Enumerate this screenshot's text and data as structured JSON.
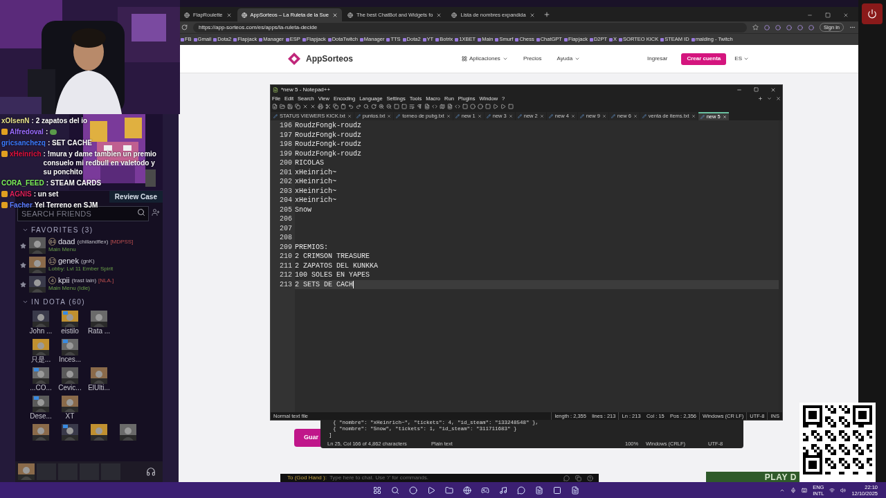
{
  "chat": {
    "messages": [
      {
        "kind": "text",
        "user": "xOlsenN",
        "color": "#e8e48a",
        "badge": false,
        "text": ": 2 zapatos del io"
      },
      {
        "kind": "emote",
        "user": "Alfredoval",
        "color": "#9b6bff",
        "badge": true,
        "text": ":"
      },
      {
        "kind": "text",
        "user": "gricsanchezq",
        "color": "#3c7bff",
        "badge": false,
        "text": ": SET CACHE"
      },
      {
        "kind": "text",
        "user": "xHeinrich",
        "color": "#e0103c",
        "badge": true,
        "text": ": !mura y dame tambien un premio consuelo mi redbull en valetodo y su ponchito"
      },
      {
        "kind": "text",
        "user": "CORA_FEED",
        "color": "#7cf05a",
        "badge": false,
        "text": ": STEAM CARDS"
      },
      {
        "kind": "text",
        "user": "AGNIS",
        "color": "#e0205a",
        "badge": true,
        "text": ": un set"
      },
      {
        "kind": "text",
        "user": "Facher",
        "color": "#5a7cff",
        "badge": true,
        "text": "Yel Terreno en SJM"
      }
    ]
  },
  "friends": {
    "review_button": "Review Case",
    "search": {
      "placeholder": "SEARCH FRIENDS"
    },
    "favorites": {
      "title": "FAVORITES",
      "count": "(3)",
      "expanded": true,
      "items": [
        {
          "level": "84",
          "name": "daad",
          "nick": "(chillandflex)",
          "tag": "[MDPSS]",
          "status": "Main Menu"
        },
        {
          "level": "12",
          "name": "genek",
          "nick": "(gnK)",
          "status": "Lobby: Lvl 11 Ember Spirit"
        },
        {
          "level": "4",
          "name": "kpii",
          "nick": "(trast lain)",
          "tag": "[NLA.]",
          "status": "Main Menu (Idle)"
        }
      ]
    },
    "in_dota": {
      "title": "IN DOTA",
      "count": "(60)",
      "expanded": true,
      "rows": [
        [
          {
            "name": "John ...",
            "plus": false
          },
          {
            "name": "eistilo",
            "plus": true
          },
          {
            "name": "Rata ...",
            "plus": false
          }
        ],
        [
          {
            "name": "只是...",
            "plus": false
          },
          {
            "name": "Inces...",
            "plus": true
          }
        ],
        [
          {
            "name": "...CO...",
            "plus": true
          },
          {
            "name": "Cevic...",
            "plus": false
          },
          {
            "name": "ElUlti...",
            "plus": false
          }
        ],
        [
          {
            "name": "Dese...",
            "plus": true
          },
          {
            "name": "XT",
            "plus": false
          }
        ],
        [
          {
            "plus": false
          },
          {
            "plus": true
          },
          {
            "plus": false
          },
          {
            "plus": false
          }
        ]
      ]
    }
  },
  "browser": {
    "tabs": [
      {
        "title": "FlapRoulette",
        "selected": false
      },
      {
        "title": "AppSorteos – La Ruleta de la Sue",
        "selected": true
      },
      {
        "title": "The best ChatBot and Widgets fo",
        "selected": false
      },
      {
        "title": "Lista de nombres expandida",
        "selected": false
      }
    ],
    "address": "https://app-sorteos.com/es/apps/la-ruleta-decide",
    "sign_in": "Sign in",
    "bookmarks": [
      "FB",
      "Gmail",
      "Dota2",
      "Flapjack",
      "Manager",
      "ESP",
      "Flapjack",
      "DotaTwitch",
      "Manager",
      "TTS",
      "Dota2",
      "YT",
      "Botrix",
      "1XBET",
      "Main",
      "Smurf",
      "Chess",
      "ChatGPT",
      "Flapjack",
      "D2PT",
      "X",
      "SORTEO KICK",
      "STEAM ID",
      "malding - Twitch"
    ]
  },
  "site": {
    "logo": "AppSorteos",
    "nav": [
      "Aplicaciones",
      "Precios",
      "Ayuda"
    ],
    "login": "Ingresar",
    "signup": "Crear cuenta",
    "language": "ES",
    "save_button": "Guar"
  },
  "notepad": {
    "title": "*new 5 - Notepad++",
    "menu": [
      "File",
      "Edit",
      "Search",
      "View",
      "Encoding",
      "Language",
      "Settings",
      "Tools",
      "Macro",
      "Run",
      "Plugins",
      "Window",
      "?"
    ],
    "tabs": [
      {
        "title": "STATUS VIEWERS KICK.txt",
        "selected": false
      },
      {
        "title": "puntos.txt",
        "selected": false
      },
      {
        "title": "torneo de pubg.txt",
        "selected": false
      },
      {
        "title": "new 1",
        "selected": false
      },
      {
        "title": "new 3",
        "selected": false
      },
      {
        "title": "new 2",
        "selected": false
      },
      {
        "title": "new 4",
        "selected": false
      },
      {
        "title": "new 9",
        "selected": false
      },
      {
        "title": "new 6",
        "selected": false
      },
      {
        "title": "venta de items.txt",
        "selected": false
      },
      {
        "title": "new 5",
        "selected": true
      }
    ],
    "lines": [
      {
        "number": "196",
        "text": "RoudzFongk-roudz",
        "current": false
      },
      {
        "number": "197",
        "text": "RoudzFongk-roudz",
        "current": false
      },
      {
        "number": "198",
        "text": "RoudzFongk-roudz",
        "current": false
      },
      {
        "number": "199",
        "text": "RoudzFongk-roudz",
        "current": false
      },
      {
        "number": "200",
        "text": "RICOLAS",
        "current": false
      },
      {
        "number": "201",
        "text": "xHeinrich~",
        "current": false
      },
      {
        "number": "202",
        "text": "xHeinrich~",
        "current": false
      },
      {
        "number": "203",
        "text": "xHeinrich~",
        "current": false
      },
      {
        "number": "204",
        "text": "xHeinrich~",
        "current": false
      },
      {
        "number": "205",
        "text": "Snow",
        "current": false
      },
      {
        "number": "206",
        "current": false
      },
      {
        "number": "207",
        "current": false
      },
      {
        "number": "208",
        "current": false
      },
      {
        "number": "209",
        "text": "PREMIOS:",
        "current": false
      },
      {
        "number": "210",
        "text": "2 CRIMSON TREASURE",
        "current": false
      },
      {
        "number": "211",
        "text": "2 ZAPATOS DEL KUNKKA",
        "current": false
      },
      {
        "number": "212",
        "text": "100 SOLES EN YAPES",
        "current": false
      },
      {
        "number": "213",
        "text": "2 SETS DE CACH",
        "current": true
      }
    ],
    "status": [
      "Normal text file",
      "length : 2,355    lines : 213",
      "Ln : 213    Col : 15    Pos : 2,356",
      "Windows (CR LF)",
      "UTF-8",
      "INS"
    ]
  },
  "editor2": {
    "lines": [
      "{ \"nombre\": \"xHeinrich~\", \"tickets\": 4, \"id_steam\": \"133248548\" },",
      "{ \"nombre\": \"Snow\", \"tickets\": 1, \"id_steam\": \"311711683\" }",
      "]"
    ],
    "status": [
      "Ln 25, Col 1",
      "66 of 4,862 characters",
      "Plain text",
      "100%",
      "Windows (CRLF)",
      "UTF-8"
    ]
  },
  "game_chat": {
    "target": "To (God Hand ):",
    "placeholder": "Type here to chat. Use '/' for commands.",
    "play_button": "PLAY D"
  },
  "taskbar": {
    "language": "ENG",
    "layout": "INTL",
    "time": "22:10",
    "date": "12/10/2025"
  }
}
